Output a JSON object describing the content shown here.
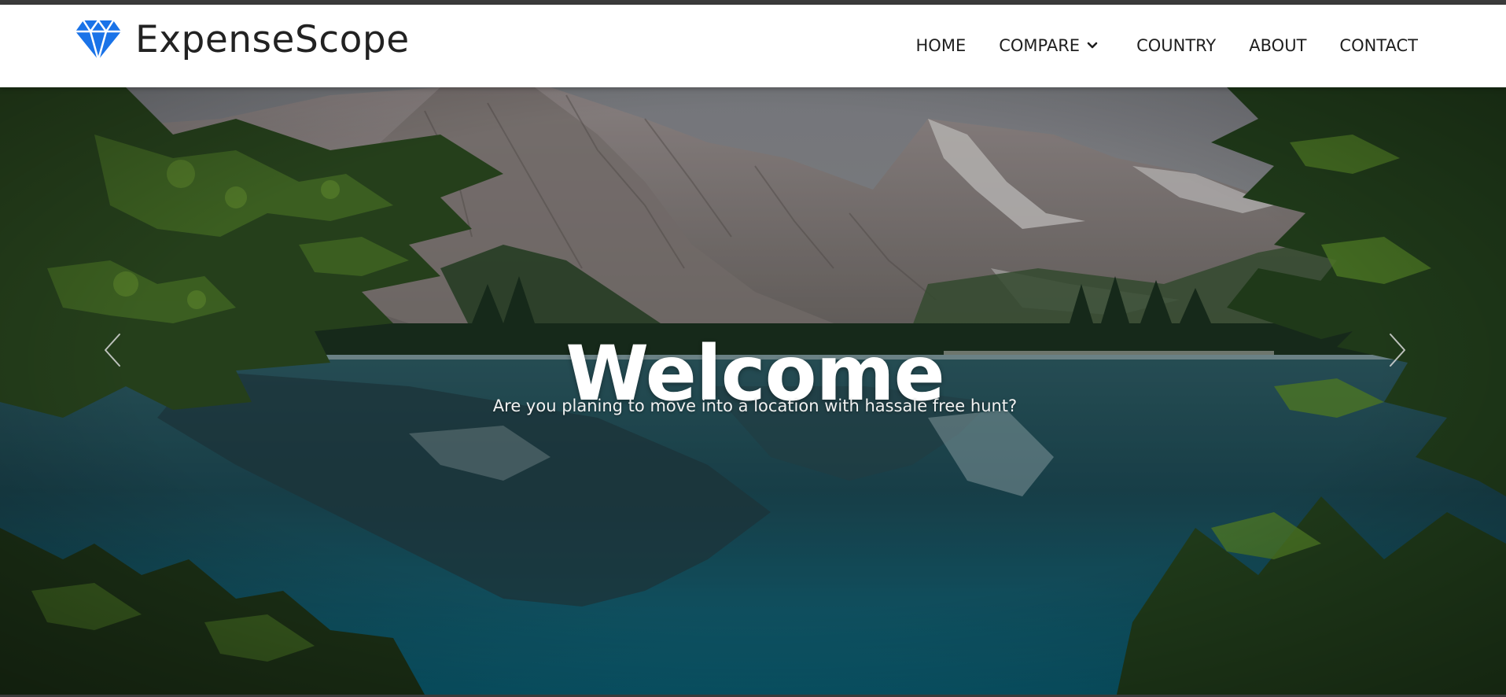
{
  "brand": {
    "name": "ExpenseScope",
    "icon": "diamond-icon",
    "accent_color": "#1a73e8"
  },
  "nav": {
    "items": [
      {
        "label": "HOME"
      },
      {
        "label": "COMPARE",
        "icon": "chevron-down-icon"
      },
      {
        "label": "COUNTRY"
      },
      {
        "label": "ABOUT"
      },
      {
        "label": "CONTACT"
      }
    ]
  },
  "hero": {
    "title": "Welcome",
    "subtitle": "Are you planing to move into a location with hassale free hunt?",
    "prev_icon": "chevron-left-icon",
    "next_icon": "chevron-right-icon"
  }
}
